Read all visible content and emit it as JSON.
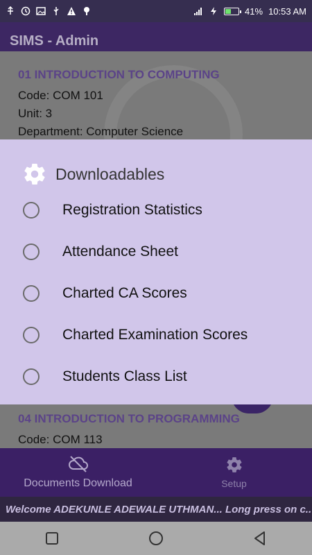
{
  "status_bar": {
    "battery_percent": "41%",
    "time": "10:53 AM",
    "icons": [
      "usb-icon",
      "circle-clock-icon",
      "image-icon",
      "usb-icon",
      "warning-icon",
      "tree-icon",
      "signal-icon",
      "charge-icon",
      "battery-icon"
    ]
  },
  "app_bar": {
    "title": "SIMS - Admin"
  },
  "content": {
    "courses": [
      {
        "title": "01 INTRODUCTION TO COMPUTING",
        "code": "Code: COM 101",
        "unit": "Unit: 3",
        "department": "Department: Computer Science"
      },
      {
        "title": "04 INTRODUCTION TO PROGRAMMING",
        "code": "Code: COM 113"
      }
    ]
  },
  "dialog": {
    "title": "Downloadables",
    "options": [
      {
        "label": "Registration Statistics"
      },
      {
        "label": "Attendance Sheet"
      },
      {
        "label": "Charted CA Scores"
      },
      {
        "label": "Charted Examination Scores"
      },
      {
        "label": "Students Class List"
      }
    ]
  },
  "bottom_nav": {
    "items": [
      {
        "label": "Documents Download",
        "icon": "cloud-off-icon"
      },
      {
        "label": "Setup",
        "icon": "gear-icon"
      }
    ]
  },
  "ticker": {
    "text": "Welcome ADEKUNLE ADEWALE UTHMAN... Long press on c.."
  },
  "colors": {
    "dialog_bg": "#d1c6ea",
    "bottom_nav_bg": "#3b2065",
    "accent": "#5b4388"
  }
}
